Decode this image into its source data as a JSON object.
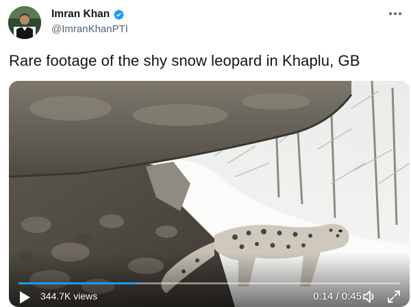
{
  "tweet": {
    "author": {
      "display_name": "Imran Khan",
      "handle": "@ImranKhanPTI",
      "verified": true,
      "avatar_icon": "profile-photo"
    },
    "more_icon": "ellipsis-icon",
    "text": "Rare footage of the shy snow leopard in Khaplu, GB",
    "media": {
      "type": "video",
      "views": "344.7K views",
      "time": "0:14 / 0:45",
      "progress_fraction": 0.31,
      "play_icon": "play-icon",
      "volume_icon": "volume-icon",
      "fullscreen_icon": "fullscreen-icon"
    }
  },
  "colors": {
    "accent": "#1d9bf0",
    "text_primary": "#0f1419",
    "text_secondary": "#536471"
  }
}
